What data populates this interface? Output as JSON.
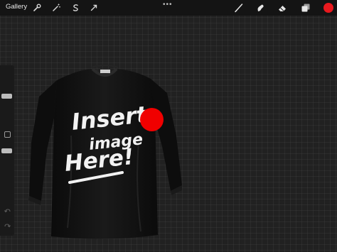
{
  "topbar": {
    "gallery_label": "Gallery",
    "left_tools": [
      "wrench-icon",
      "magic-wand-icon",
      "selection-s-icon",
      "transform-arrow-icon"
    ],
    "more_label": "•••",
    "right_tools": [
      "brush-icon",
      "smudge-icon",
      "eraser-icon",
      "layers-icon"
    ],
    "current_color": "#e8191e"
  },
  "canvas": {
    "grid": true,
    "background": "#212121",
    "artwork": {
      "description_icon": "long-sleeve-tshirt",
      "print_lines": [
        "Insert",
        "image",
        "Here!"
      ],
      "marker_color": "#f00000"
    }
  },
  "sidebar": {
    "controls": [
      "brush-size-slider",
      "modify-button",
      "opacity-slider",
      "undo-button",
      "redo-button"
    ]
  }
}
